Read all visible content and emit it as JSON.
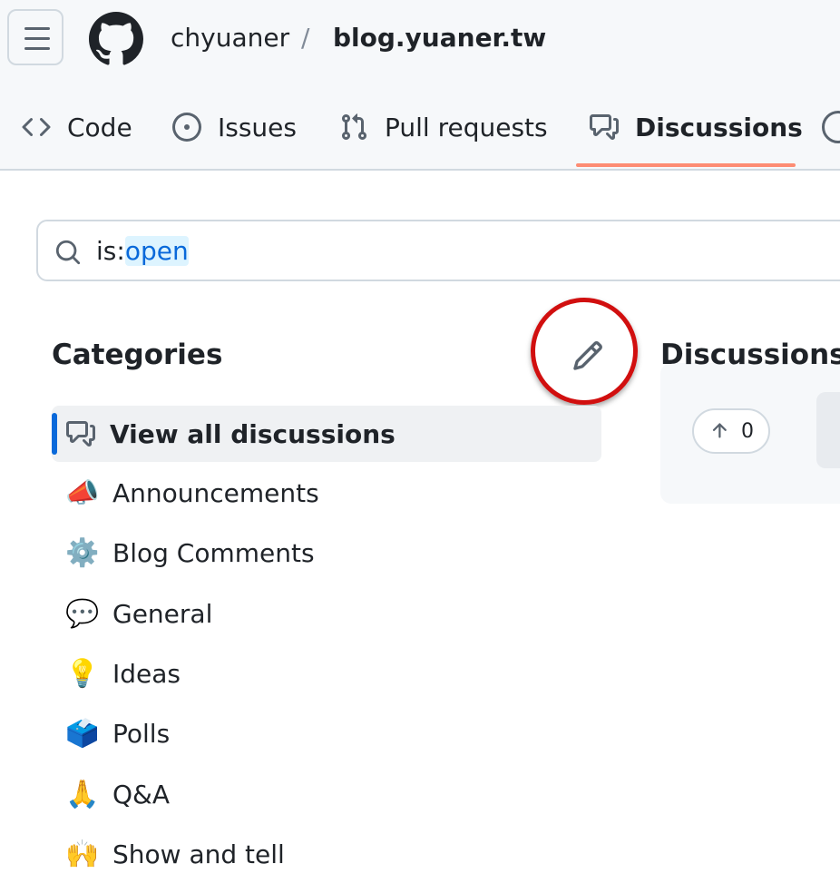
{
  "header": {
    "owner": "chyuaner",
    "separator": "/",
    "repo": "blog.yuaner.tw",
    "tabs": [
      {
        "label": "Code",
        "icon": "code-icon"
      },
      {
        "label": "Issues",
        "icon": "issue-opened-icon"
      },
      {
        "label": "Pull requests",
        "icon": "git-pull-request-icon"
      },
      {
        "label": "Discussions",
        "icon": "comment-discussion-icon",
        "active": true
      }
    ]
  },
  "search": {
    "qualifier": "is:",
    "value": "open"
  },
  "categories": {
    "title": "Categories",
    "items": [
      {
        "label": "View all discussions",
        "icon": "comment-discussion-icon",
        "selected": true
      },
      {
        "label": "Announcements",
        "emoji": "📣"
      },
      {
        "label": "Blog Comments",
        "emoji": "⚙️"
      },
      {
        "label": "General",
        "emoji": "💬"
      },
      {
        "label": "Ideas",
        "emoji": "💡"
      },
      {
        "label": "Polls",
        "emoji": "🗳️"
      },
      {
        "label": "Q&A",
        "emoji": "🙏"
      },
      {
        "label": "Show and tell",
        "emoji": "🙌"
      }
    ]
  },
  "discussions": {
    "title": "Discussions",
    "first_upvotes": "0"
  },
  "colors": {
    "accent": "#0969da",
    "tab_underline": "#fd8c73",
    "annotation": "#d10f0f"
  }
}
